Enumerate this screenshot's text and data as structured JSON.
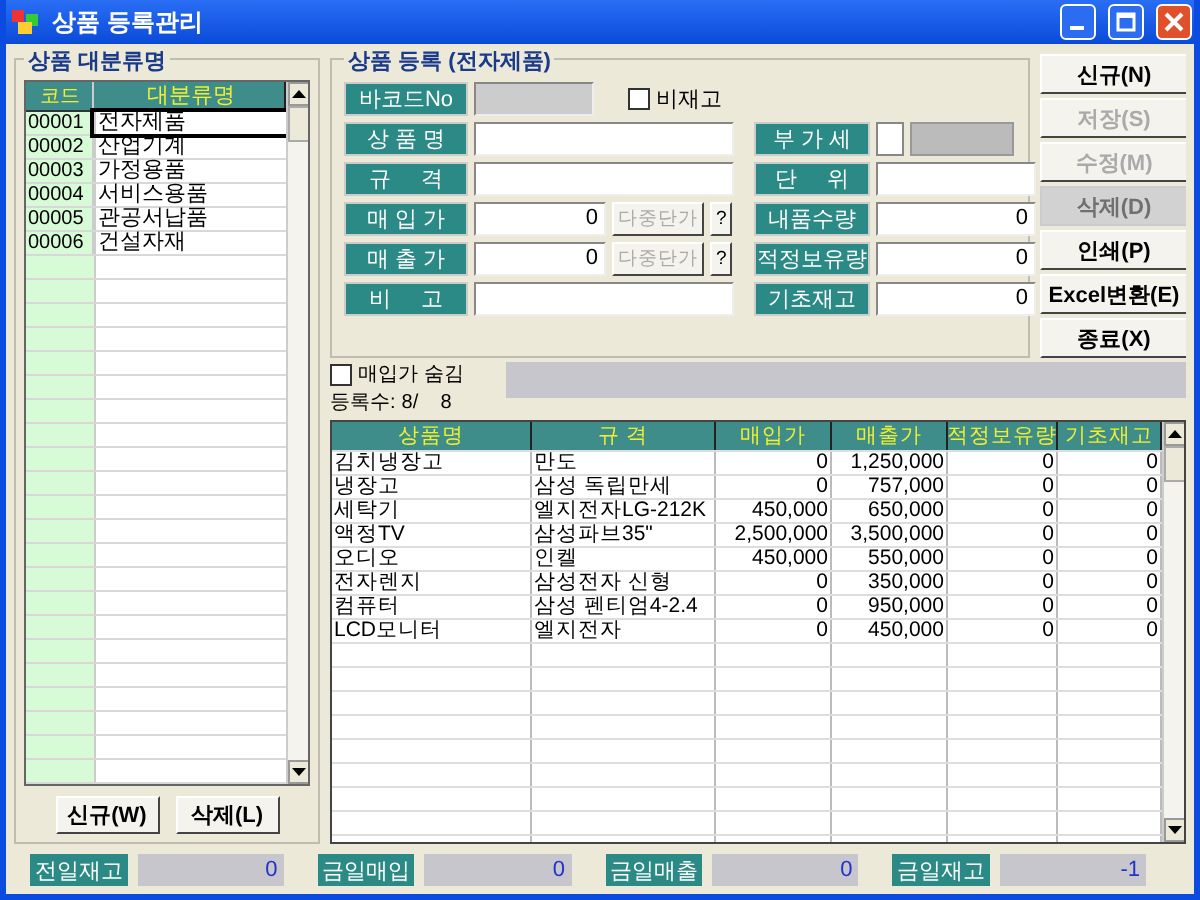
{
  "window": {
    "title": "상품 등록관리"
  },
  "category_panel": {
    "title": "상품 대분류명",
    "columns": [
      "코드",
      "대분류명"
    ],
    "rows": [
      {
        "code": "00001",
        "name": "전자제품",
        "selected": true
      },
      {
        "code": "00002",
        "name": "산업기계",
        "selected": false
      },
      {
        "code": "00003",
        "name": "가정용품",
        "selected": false
      },
      {
        "code": "00004",
        "name": "서비스용품",
        "selected": false
      },
      {
        "code": "00005",
        "name": "관공서납품",
        "selected": false
      },
      {
        "code": "00006",
        "name": "건설자재",
        "selected": false
      }
    ],
    "buttons": [
      {
        "label": "신규(W)"
      },
      {
        "label": "삭제(L)"
      }
    ]
  },
  "product_form": {
    "title": "상품 등록 (전자제품)",
    "left_fields": [
      {
        "label": "바코드No",
        "kind": "readonly",
        "checkbox": {
          "label": "비재고",
          "checked": false
        }
      },
      {
        "label": "상 품 명",
        "kind": "text"
      },
      {
        "label": "규     격",
        "kind": "text"
      },
      {
        "label": "매 입 가",
        "kind": "price",
        "value": "0",
        "buttons": [
          {
            "label": "다중단가",
            "disabled": true
          },
          {
            "label": "?",
            "disabled": false
          }
        ]
      },
      {
        "label": "매 출 가",
        "kind": "price",
        "value": "0",
        "buttons": [
          {
            "label": "다중단가",
            "disabled": true
          },
          {
            "label": "?",
            "disabled": false
          }
        ]
      },
      {
        "label": "비     고",
        "kind": "text"
      }
    ],
    "right_fields": [
      {
        "label": "부 가 세",
        "kind": "check",
        "checked": false
      },
      {
        "label": "단     위",
        "kind": "text"
      },
      {
        "label": "내품수량",
        "kind": "number",
        "value": "0"
      },
      {
        "label": "적정보유량",
        "kind": "number",
        "value": "0"
      },
      {
        "label": "기초재고",
        "kind": "number",
        "value": "0"
      }
    ]
  },
  "action_buttons": [
    {
      "label": "신규(N)",
      "disabled": false,
      "pressed": false
    },
    {
      "label": "저장(S)",
      "disabled": true,
      "pressed": false
    },
    {
      "label": "수정(M)",
      "disabled": true,
      "pressed": false
    },
    {
      "label": "삭제(D)",
      "disabled": true,
      "pressed": true
    },
    {
      "label": "인쇄(P)",
      "disabled": false,
      "pressed": false
    },
    {
      "label": "Excel변환(E)",
      "disabled": false,
      "pressed": false
    },
    {
      "label": "종료(X)",
      "disabled": false,
      "pressed": false
    }
  ],
  "hide_cost": {
    "label": "매입가 숨김",
    "checked": false
  },
  "count": {
    "label": "등록수:",
    "value": "8/    8"
  },
  "product_table": {
    "columns": [
      "상품명",
      "규 격",
      "매입가",
      "매출가",
      "적정보유량",
      "기초재고"
    ],
    "rows": [
      [
        "김치냉장고",
        "만도",
        "0",
        "1,250,000",
        "0",
        "0"
      ],
      [
        "냉장고",
        "삼성 독립만세",
        "0",
        "757,000",
        "0",
        "0"
      ],
      [
        "세탁기",
        "엘지전자LG-212K",
        "450,000",
        "650,000",
        "0",
        "0"
      ],
      [
        "액정TV",
        "삼성파브35\"",
        "2,500,000",
        "3,500,000",
        "0",
        "0"
      ],
      [
        "오디오",
        "인켈",
        "450,000",
        "550,000",
        "0",
        "0"
      ],
      [
        "전자렌지",
        "삼성전자 신형",
        "0",
        "350,000",
        "0",
        "0"
      ],
      [
        "컴퓨터",
        "삼성 펜티엄4-2.4",
        "0",
        "950,000",
        "0",
        "0"
      ],
      [
        "LCD모니터",
        "엘지전자",
        "0",
        "450,000",
        "0",
        "0"
      ]
    ]
  },
  "status_bar": [
    {
      "label": "전일재고",
      "value": "0"
    },
    {
      "label": "금일매입",
      "value": "0"
    },
    {
      "label": "금일매출",
      "value": "0"
    },
    {
      "label": "금일재고",
      "value": "-1"
    }
  ]
}
